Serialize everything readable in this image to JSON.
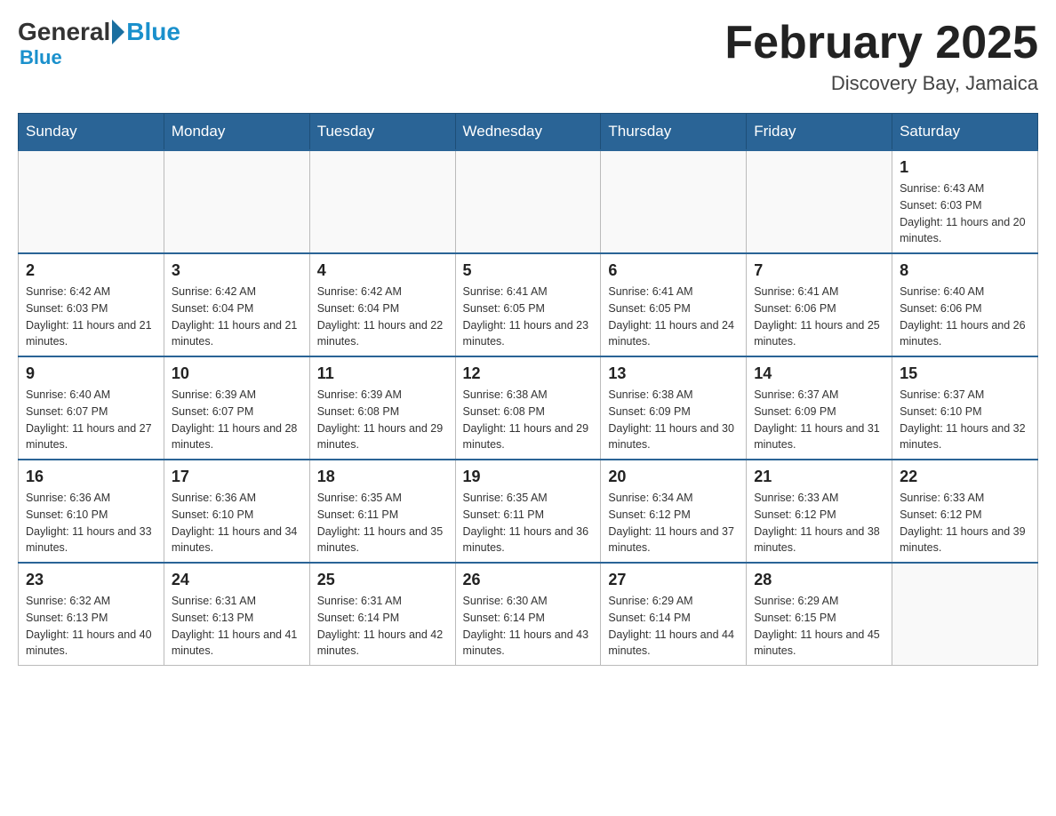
{
  "header": {
    "logo_general": "General",
    "logo_blue": "Blue",
    "month_title": "February 2025",
    "location": "Discovery Bay, Jamaica"
  },
  "days_of_week": [
    "Sunday",
    "Monday",
    "Tuesday",
    "Wednesday",
    "Thursday",
    "Friday",
    "Saturday"
  ],
  "weeks": [
    [
      {
        "day": "",
        "info": ""
      },
      {
        "day": "",
        "info": ""
      },
      {
        "day": "",
        "info": ""
      },
      {
        "day": "",
        "info": ""
      },
      {
        "day": "",
        "info": ""
      },
      {
        "day": "",
        "info": ""
      },
      {
        "day": "1",
        "info": "Sunrise: 6:43 AM\nSunset: 6:03 PM\nDaylight: 11 hours and 20 minutes."
      }
    ],
    [
      {
        "day": "2",
        "info": "Sunrise: 6:42 AM\nSunset: 6:03 PM\nDaylight: 11 hours and 21 minutes."
      },
      {
        "day": "3",
        "info": "Sunrise: 6:42 AM\nSunset: 6:04 PM\nDaylight: 11 hours and 21 minutes."
      },
      {
        "day": "4",
        "info": "Sunrise: 6:42 AM\nSunset: 6:04 PM\nDaylight: 11 hours and 22 minutes."
      },
      {
        "day": "5",
        "info": "Sunrise: 6:41 AM\nSunset: 6:05 PM\nDaylight: 11 hours and 23 minutes."
      },
      {
        "day": "6",
        "info": "Sunrise: 6:41 AM\nSunset: 6:05 PM\nDaylight: 11 hours and 24 minutes."
      },
      {
        "day": "7",
        "info": "Sunrise: 6:41 AM\nSunset: 6:06 PM\nDaylight: 11 hours and 25 minutes."
      },
      {
        "day": "8",
        "info": "Sunrise: 6:40 AM\nSunset: 6:06 PM\nDaylight: 11 hours and 26 minutes."
      }
    ],
    [
      {
        "day": "9",
        "info": "Sunrise: 6:40 AM\nSunset: 6:07 PM\nDaylight: 11 hours and 27 minutes."
      },
      {
        "day": "10",
        "info": "Sunrise: 6:39 AM\nSunset: 6:07 PM\nDaylight: 11 hours and 28 minutes."
      },
      {
        "day": "11",
        "info": "Sunrise: 6:39 AM\nSunset: 6:08 PM\nDaylight: 11 hours and 29 minutes."
      },
      {
        "day": "12",
        "info": "Sunrise: 6:38 AM\nSunset: 6:08 PM\nDaylight: 11 hours and 29 minutes."
      },
      {
        "day": "13",
        "info": "Sunrise: 6:38 AM\nSunset: 6:09 PM\nDaylight: 11 hours and 30 minutes."
      },
      {
        "day": "14",
        "info": "Sunrise: 6:37 AM\nSunset: 6:09 PM\nDaylight: 11 hours and 31 minutes."
      },
      {
        "day": "15",
        "info": "Sunrise: 6:37 AM\nSunset: 6:10 PM\nDaylight: 11 hours and 32 minutes."
      }
    ],
    [
      {
        "day": "16",
        "info": "Sunrise: 6:36 AM\nSunset: 6:10 PM\nDaylight: 11 hours and 33 minutes."
      },
      {
        "day": "17",
        "info": "Sunrise: 6:36 AM\nSunset: 6:10 PM\nDaylight: 11 hours and 34 minutes."
      },
      {
        "day": "18",
        "info": "Sunrise: 6:35 AM\nSunset: 6:11 PM\nDaylight: 11 hours and 35 minutes."
      },
      {
        "day": "19",
        "info": "Sunrise: 6:35 AM\nSunset: 6:11 PM\nDaylight: 11 hours and 36 minutes."
      },
      {
        "day": "20",
        "info": "Sunrise: 6:34 AM\nSunset: 6:12 PM\nDaylight: 11 hours and 37 minutes."
      },
      {
        "day": "21",
        "info": "Sunrise: 6:33 AM\nSunset: 6:12 PM\nDaylight: 11 hours and 38 minutes."
      },
      {
        "day": "22",
        "info": "Sunrise: 6:33 AM\nSunset: 6:12 PM\nDaylight: 11 hours and 39 minutes."
      }
    ],
    [
      {
        "day": "23",
        "info": "Sunrise: 6:32 AM\nSunset: 6:13 PM\nDaylight: 11 hours and 40 minutes."
      },
      {
        "day": "24",
        "info": "Sunrise: 6:31 AM\nSunset: 6:13 PM\nDaylight: 11 hours and 41 minutes."
      },
      {
        "day": "25",
        "info": "Sunrise: 6:31 AM\nSunset: 6:14 PM\nDaylight: 11 hours and 42 minutes."
      },
      {
        "day": "26",
        "info": "Sunrise: 6:30 AM\nSunset: 6:14 PM\nDaylight: 11 hours and 43 minutes."
      },
      {
        "day": "27",
        "info": "Sunrise: 6:29 AM\nSunset: 6:14 PM\nDaylight: 11 hours and 44 minutes."
      },
      {
        "day": "28",
        "info": "Sunrise: 6:29 AM\nSunset: 6:15 PM\nDaylight: 11 hours and 45 minutes."
      },
      {
        "day": "",
        "info": ""
      }
    ]
  ]
}
